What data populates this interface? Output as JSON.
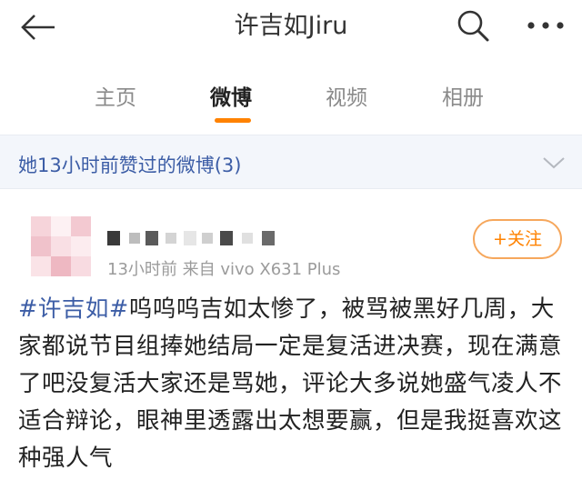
{
  "header": {
    "title": "许吉如Jiru",
    "back_icon": "back-arrow-icon",
    "search_icon": "search-icon",
    "more_icon": "more-options-icon"
  },
  "tabs": [
    {
      "label": "主页",
      "active": false
    },
    {
      "label": "微博",
      "active": true
    },
    {
      "label": "视频",
      "active": false
    },
    {
      "label": "相册",
      "active": false
    }
  ],
  "colors": {
    "accent": "#ff8200",
    "link": "#3c5da6",
    "liked_bar_bg": "#f3f6fb"
  },
  "liked": {
    "text": "她13小时前赞过的微博(3)",
    "chevron_icon": "chevron-down-icon"
  },
  "post": {
    "meta": "13小时前  来自 vivo X631 Plus",
    "follow_label": "+关注",
    "hashtag": "#许吉如#",
    "body": "呜呜呜吉如太惨了，被骂被黑好几周，大家都说节目组捧她结局一定是复活进决赛，现在满意了吧没复活大家还是骂她，评论大多说她盛气凌人不适合辩论，眼神里透露出太想要赢，但是我挺喜欢这种强人气"
  }
}
